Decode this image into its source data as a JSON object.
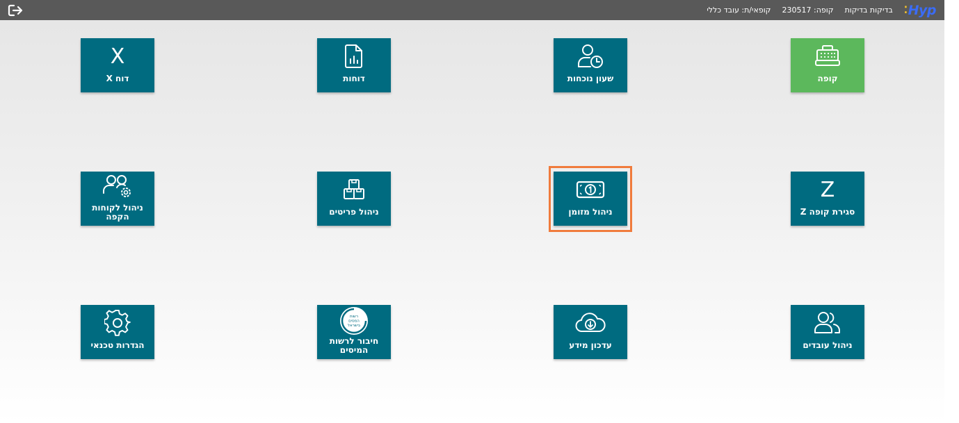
{
  "topbar": {
    "brand": "Hyp",
    "brand_dots": "⁚",
    "business": "בדיקות בדיקות",
    "register": "קופה: 230517",
    "cashier": "קופאי/ת: עובד כללי"
  },
  "tiles": [
    {
      "label": "קופה",
      "icon": "cash-register-icon"
    },
    {
      "label": "שעון נוכחות",
      "icon": "user-clock-icon"
    },
    {
      "label": "דוחות",
      "icon": "report-file-icon"
    },
    {
      "label": "דוח X",
      "icon": "x-letter-icon",
      "glyph": "X"
    },
    {
      "label": "סגירת קופה Z",
      "icon": "z-letter-icon",
      "glyph": "Z"
    },
    {
      "label": "ניהול מזומן",
      "icon": "cash-banknote-icon"
    },
    {
      "label": "ניהול פריטים",
      "icon": "boxes-icon"
    },
    {
      "label": "ניהול לקוחות הקפה",
      "icon": "users-gear-icon"
    },
    {
      "label": "ניהול עובדים",
      "icon": "users-icon"
    },
    {
      "label": "עדכון מידע",
      "icon": "cloud-download-icon"
    },
    {
      "label": "חיבור לרשות המיסים",
      "icon": "tax-authority-logo",
      "logo_text": "רשות המסים בישראל"
    },
    {
      "label": "הגדרות טכנאי",
      "icon": "gear-icon"
    }
  ],
  "colors": {
    "tile": "#006b80",
    "tile_active": "#5cb85c",
    "topbar": "#595959",
    "highlight": "#f07b3c",
    "brand": "#3b6cf5"
  }
}
